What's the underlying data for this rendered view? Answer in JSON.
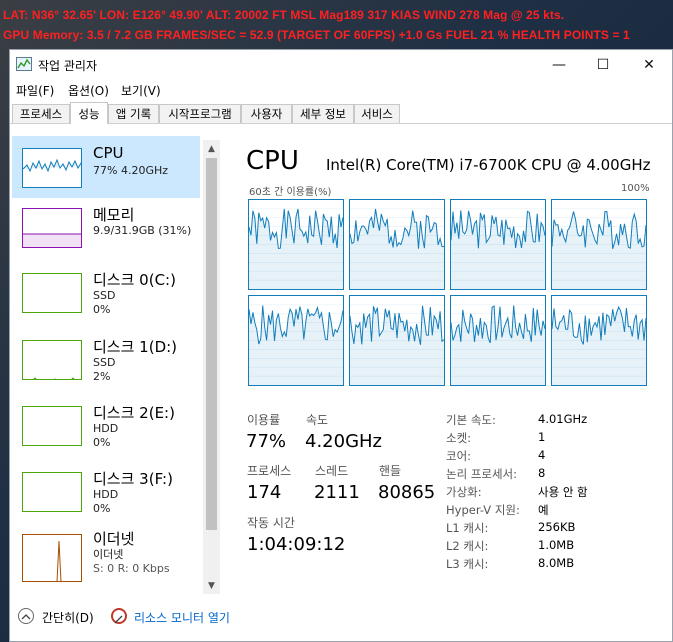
{
  "hud": {
    "line1": "LAT: N36° 32.65'  LON: E126° 49.90'  ALT: 20002 FT  MSL   Mag189  317 KIAS  WIND 278 Mag @ 25 kts.",
    "line2": "GPU Memory: 3.5 / 7.2 GB  FRAMES/SEC = 52.9   (TARGET OF 60FPS)   +1.0 Gs   FUEL 21 %   HEALTH POINTS = 1",
    "color": "#ff2020"
  },
  "window": {
    "title": "작업 관리자",
    "min_glyph": "—",
    "max_glyph": "☐",
    "close_glyph": "✕"
  },
  "menu": [
    "파일(F)",
    "옵션(O)",
    "보기(V)"
  ],
  "tabs": [
    "프로세스",
    "성능",
    "앱 기록",
    "시작프로그램",
    "사용자",
    "세부 정보",
    "서비스"
  ],
  "active_tab": "성능",
  "sidebar": {
    "items": [
      {
        "title": "CPU",
        "line1": "77% 4.20GHz",
        "line2": "",
        "color": "#117dbb"
      },
      {
        "title": "메모리",
        "line1": "9.9/31.9GB (31%)",
        "line2": "",
        "color": "#8b12ae"
      },
      {
        "title": "디스크 0(C:)",
        "line1": "SSD",
        "line2": "0%",
        "color": "#4da60c"
      },
      {
        "title": "디스크 1(D:)",
        "line1": "SSD",
        "line2": "2%",
        "color": "#4da60c"
      },
      {
        "title": "디스크 2(E:)",
        "line1": "HDD",
        "line2": "0%",
        "color": "#4da60c"
      },
      {
        "title": "디스크 3(F:)",
        "line1": "HDD",
        "line2": "0%",
        "color": "#4da60c"
      },
      {
        "title": "이더넷",
        "line1": "이더넷",
        "line2": "S: 0 R: 0 Kbps",
        "color": "#a74f01"
      }
    ],
    "scroll_up": "▲",
    "scroll_down": "▼"
  },
  "main": {
    "title": "CPU",
    "model": "Intel(R) Core(TM) i7-6700K CPU @ 4.00GHz",
    "graph_label": "60초 간 이용률(%)",
    "graph_max": "100%",
    "stats": {
      "util_label": "이용률",
      "util_value": "77%",
      "speed_label": "속도",
      "speed_value": "4.20GHz",
      "proc_label": "프로세스",
      "proc_value": "174",
      "thread_label": "스레드",
      "thread_value": "2111",
      "handle_label": "핸들",
      "handle_value": "80865",
      "uptime_label": "작동 시간",
      "uptime_value": "1:04:09:12"
    },
    "info": [
      {
        "label": "기본 속도:",
        "value": "4.01GHz"
      },
      {
        "label": "소켓:",
        "value": "1"
      },
      {
        "label": "코어:",
        "value": "4"
      },
      {
        "label": "논리 프로세서:",
        "value": "8"
      },
      {
        "label": "가상화:",
        "value": "사용 안 함"
      },
      {
        "label": "Hyper-V 지원:",
        "value": "예"
      },
      {
        "label": "L1 캐시:",
        "value": "256KB"
      },
      {
        "label": "L2 캐시:",
        "value": "1.0MB"
      },
      {
        "label": "L3 캐시:",
        "value": "8.0MB"
      }
    ],
    "accent": "#117dbb"
  },
  "footer": {
    "fewer_details": "간단히(D)",
    "resource_monitor": "리소스 모니터 열기",
    "link_color": "#0066cc"
  }
}
